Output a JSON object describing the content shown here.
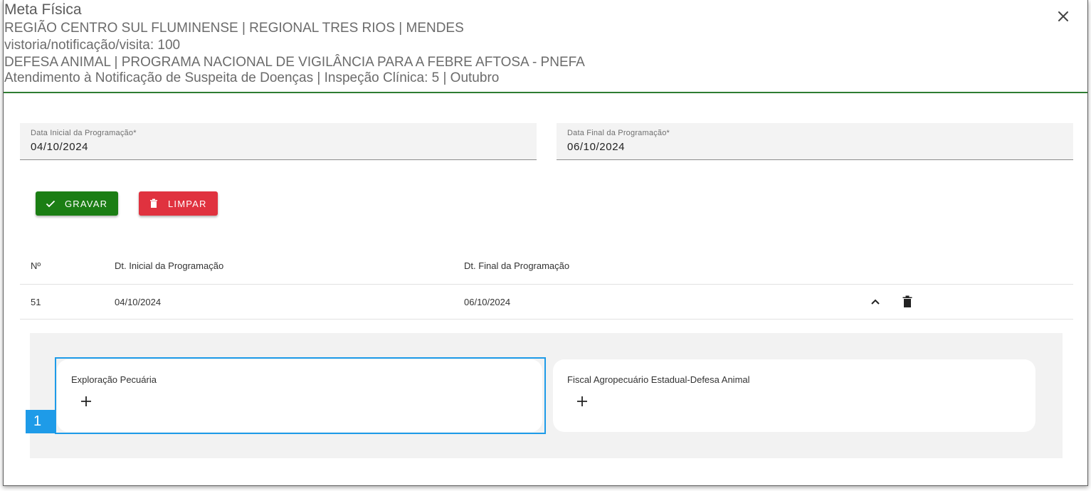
{
  "header": {
    "title": "Meta Física",
    "lines": [
      "REGIÃO CENTRO SUL FLUMINENSE | REGIONAL TRES RIOS | MENDES",
      "vistoria/notificação/visita: 100",
      "DEFESA ANIMAL | PROGRAMA NACIONAL DE VIGILÂNCIA PARA A FEBRE AFTOSA - PNEFA",
      "Atendimento à Notificação de Suspeita de Doenças | Inspeção Clínica: 5 | Outubro"
    ],
    "close_icon": "close-icon"
  },
  "form": {
    "start": {
      "label": "Data Inicial da Programação*",
      "value": "04/10/2024"
    },
    "end": {
      "label": "Data Final da Programação*",
      "value": "06/10/2024"
    }
  },
  "actions": {
    "save_label": "GRAVAR",
    "save_icon": "check-icon",
    "save_color": "#1b7e14",
    "clear_label": "LIMPAR",
    "clear_icon": "trash-icon",
    "clear_color": "#e0323f"
  },
  "table": {
    "headers": [
      "Nº",
      "Dt. Inicial da Programação",
      "Dt. Final da Programação"
    ],
    "rows": [
      {
        "num": "51",
        "start": "04/10/2024",
        "end": "06/10/2024"
      }
    ]
  },
  "detail": {
    "cards": [
      {
        "title": "Exploração Pecuária",
        "add_icon": "plus-icon"
      },
      {
        "title": "Fiscal Agropecuário Estadual-Defesa Animal",
        "add_icon": "plus-icon"
      }
    ],
    "selection_tag": "1",
    "selection_color": "#1e9be8"
  },
  "theme": {
    "header_border": "#2e7d32"
  }
}
